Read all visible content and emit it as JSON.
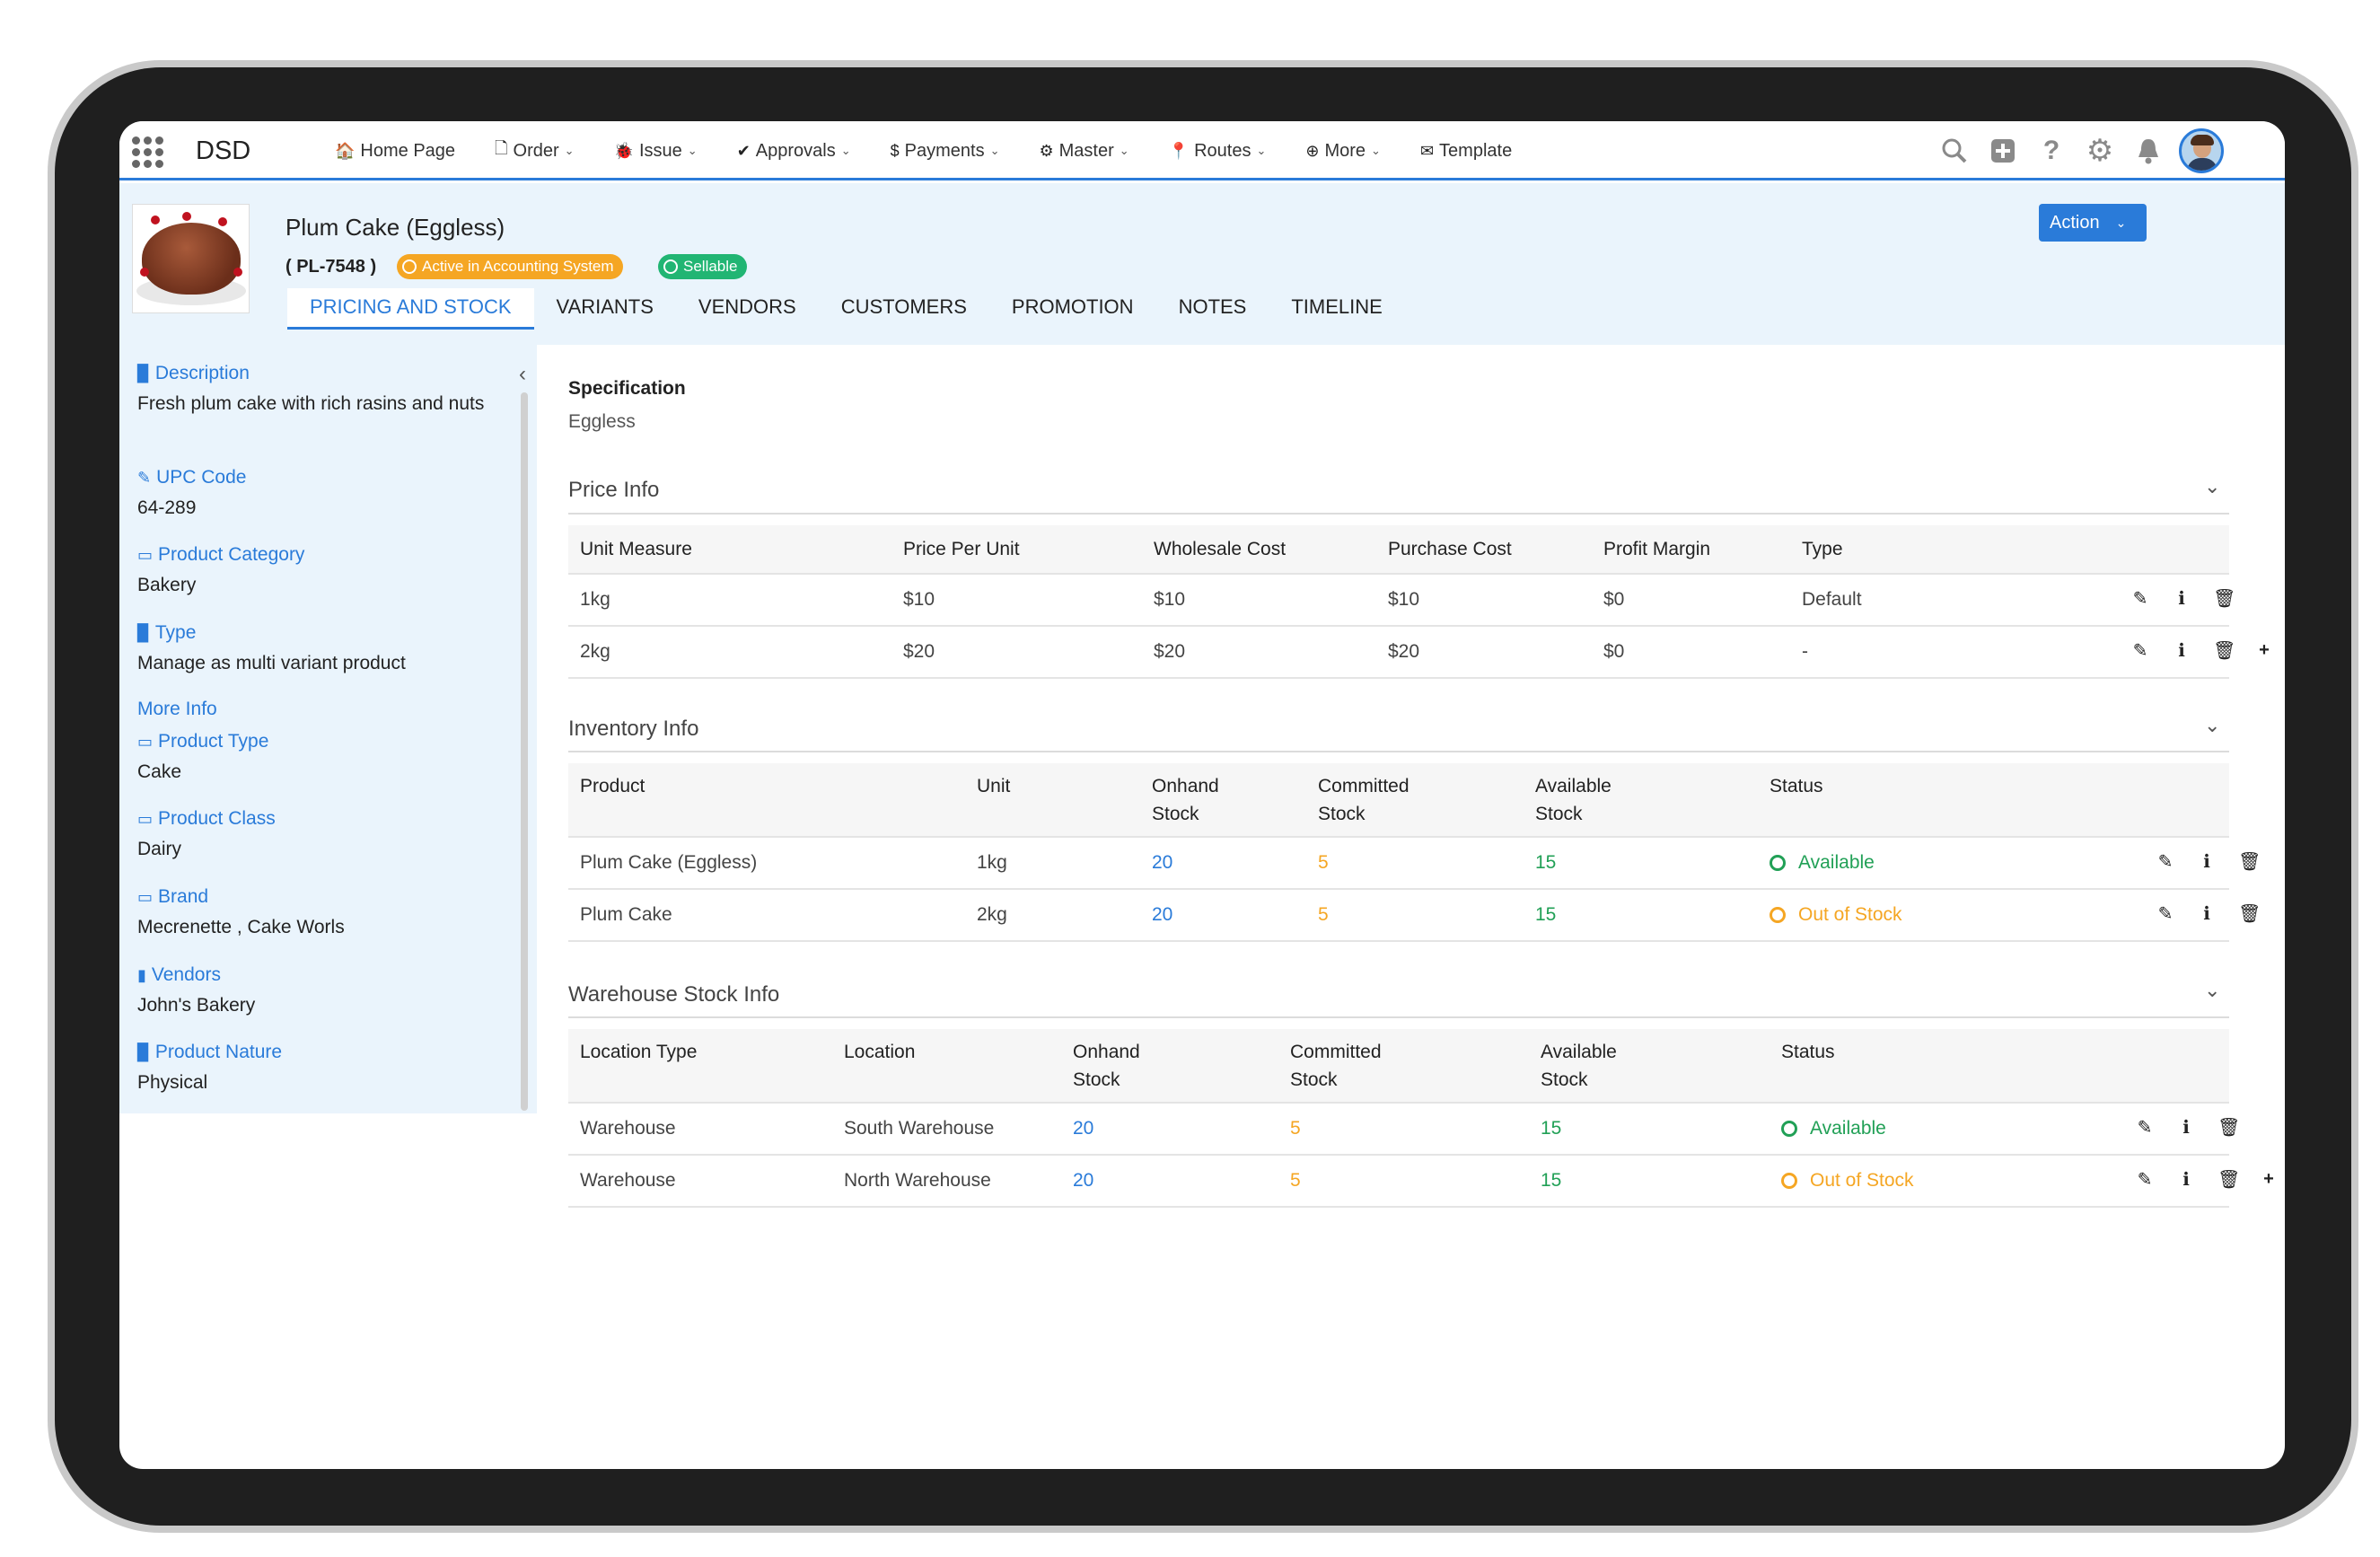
{
  "app": {
    "brand": "DSD"
  },
  "nav": [
    {
      "icon": "home-icon",
      "glyph": "🏠",
      "label": "Home Page",
      "caret": ""
    },
    {
      "icon": "document-icon",
      "glyph": "🗋",
      "label": "Order",
      "caret": "⌄"
    },
    {
      "icon": "bug-icon",
      "glyph": "🐞",
      "label": "Issue",
      "caret": "⌄"
    },
    {
      "icon": "check-icon",
      "glyph": "✔",
      "label": "Approvals",
      "caret": "⌄"
    },
    {
      "icon": "dollar-icon",
      "glyph": "$",
      "label": "Payments",
      "caret": "⌄"
    },
    {
      "icon": "gear-icon",
      "glyph": "⚙",
      "label": "Master",
      "caret": "⌄"
    },
    {
      "icon": "map-pin-icon",
      "glyph": "📍",
      "label": "Routes",
      "caret": "⌄"
    },
    {
      "icon": "plus-circle-icon",
      "glyph": "⊕",
      "label": "More",
      "caret": "⌄"
    },
    {
      "icon": "envelope-icon",
      "glyph": "✉",
      "label": "Template",
      "caret": ""
    }
  ],
  "product": {
    "title": "Plum Cake (Eggless)",
    "code": "( PL-7548 )",
    "badge_accounting": "Active in Accounting System",
    "badge_sellable": "Sellable",
    "action_label": "Action"
  },
  "tabs": [
    "PRICING AND STOCK",
    "VARIANTS",
    "VENDORS",
    "CUSTOMERS",
    "PROMOTION",
    "NOTES",
    "TIMELINE"
  ],
  "sidebar": {
    "description_label": "Description",
    "description_value": "Fresh plum cake with rich rasins and nuts",
    "upc_label": "UPC Code",
    "upc_value": "64-289",
    "category_label": "Product Category",
    "category_value": "Bakery",
    "type_label": "Type",
    "type_value": "Manage as multi variant product",
    "more_info": "More Info",
    "product_type_label": "Product Type",
    "product_type_value": "Cake",
    "class_label": "Product Class",
    "class_value": "Dairy",
    "brand_label": "Brand",
    "brand_value": "Mecrenette , Cake Worls",
    "vendors_label": "Vendors",
    "vendors_value": "John's Bakery",
    "nature_label": "Product Nature",
    "nature_value": "Physical"
  },
  "spec": {
    "title": "Specification",
    "value": "Eggless"
  },
  "price": {
    "title": "Price Info",
    "headers": [
      "Unit Measure",
      "Price Per Unit",
      "Wholesale Cost",
      "Purchase Cost",
      "Profit Margin",
      "Type"
    ],
    "rows": [
      [
        "1kg",
        "$10",
        "$10",
        "$10",
        "$0",
        "Default"
      ],
      [
        "2kg",
        "$20",
        "$20",
        "$20",
        "$0",
        "-"
      ]
    ]
  },
  "inventory": {
    "title": "Inventory Info",
    "headers": [
      "Product",
      "Unit",
      "Onhand\nStock",
      "Committed\nStock",
      "Available\nStock",
      "Status"
    ],
    "rows": [
      [
        "Plum Cake (Eggless)",
        "1kg",
        "20",
        "5",
        "15",
        "Available"
      ],
      [
        "Plum Cake",
        "2kg",
        "20",
        "5",
        "15",
        "Out of Stock"
      ]
    ]
  },
  "warehouse": {
    "title": "Warehouse Stock Info",
    "headers": [
      "Location Type",
      "Location",
      "Onhand\nStock",
      "Committed\nStock",
      "Available\nStock",
      "Status"
    ],
    "rows": [
      [
        "Warehouse",
        "South Warehouse",
        "20",
        "5",
        "15",
        "Available"
      ],
      [
        "Warehouse",
        "North Warehouse",
        "20",
        "5",
        "15",
        "Out of Stock"
      ]
    ]
  },
  "colors": {
    "accent": "#2a7bd9",
    "available": "#21a056",
    "out_of_stock": "#f5a623",
    "header_bg": "#eaf4fc"
  }
}
